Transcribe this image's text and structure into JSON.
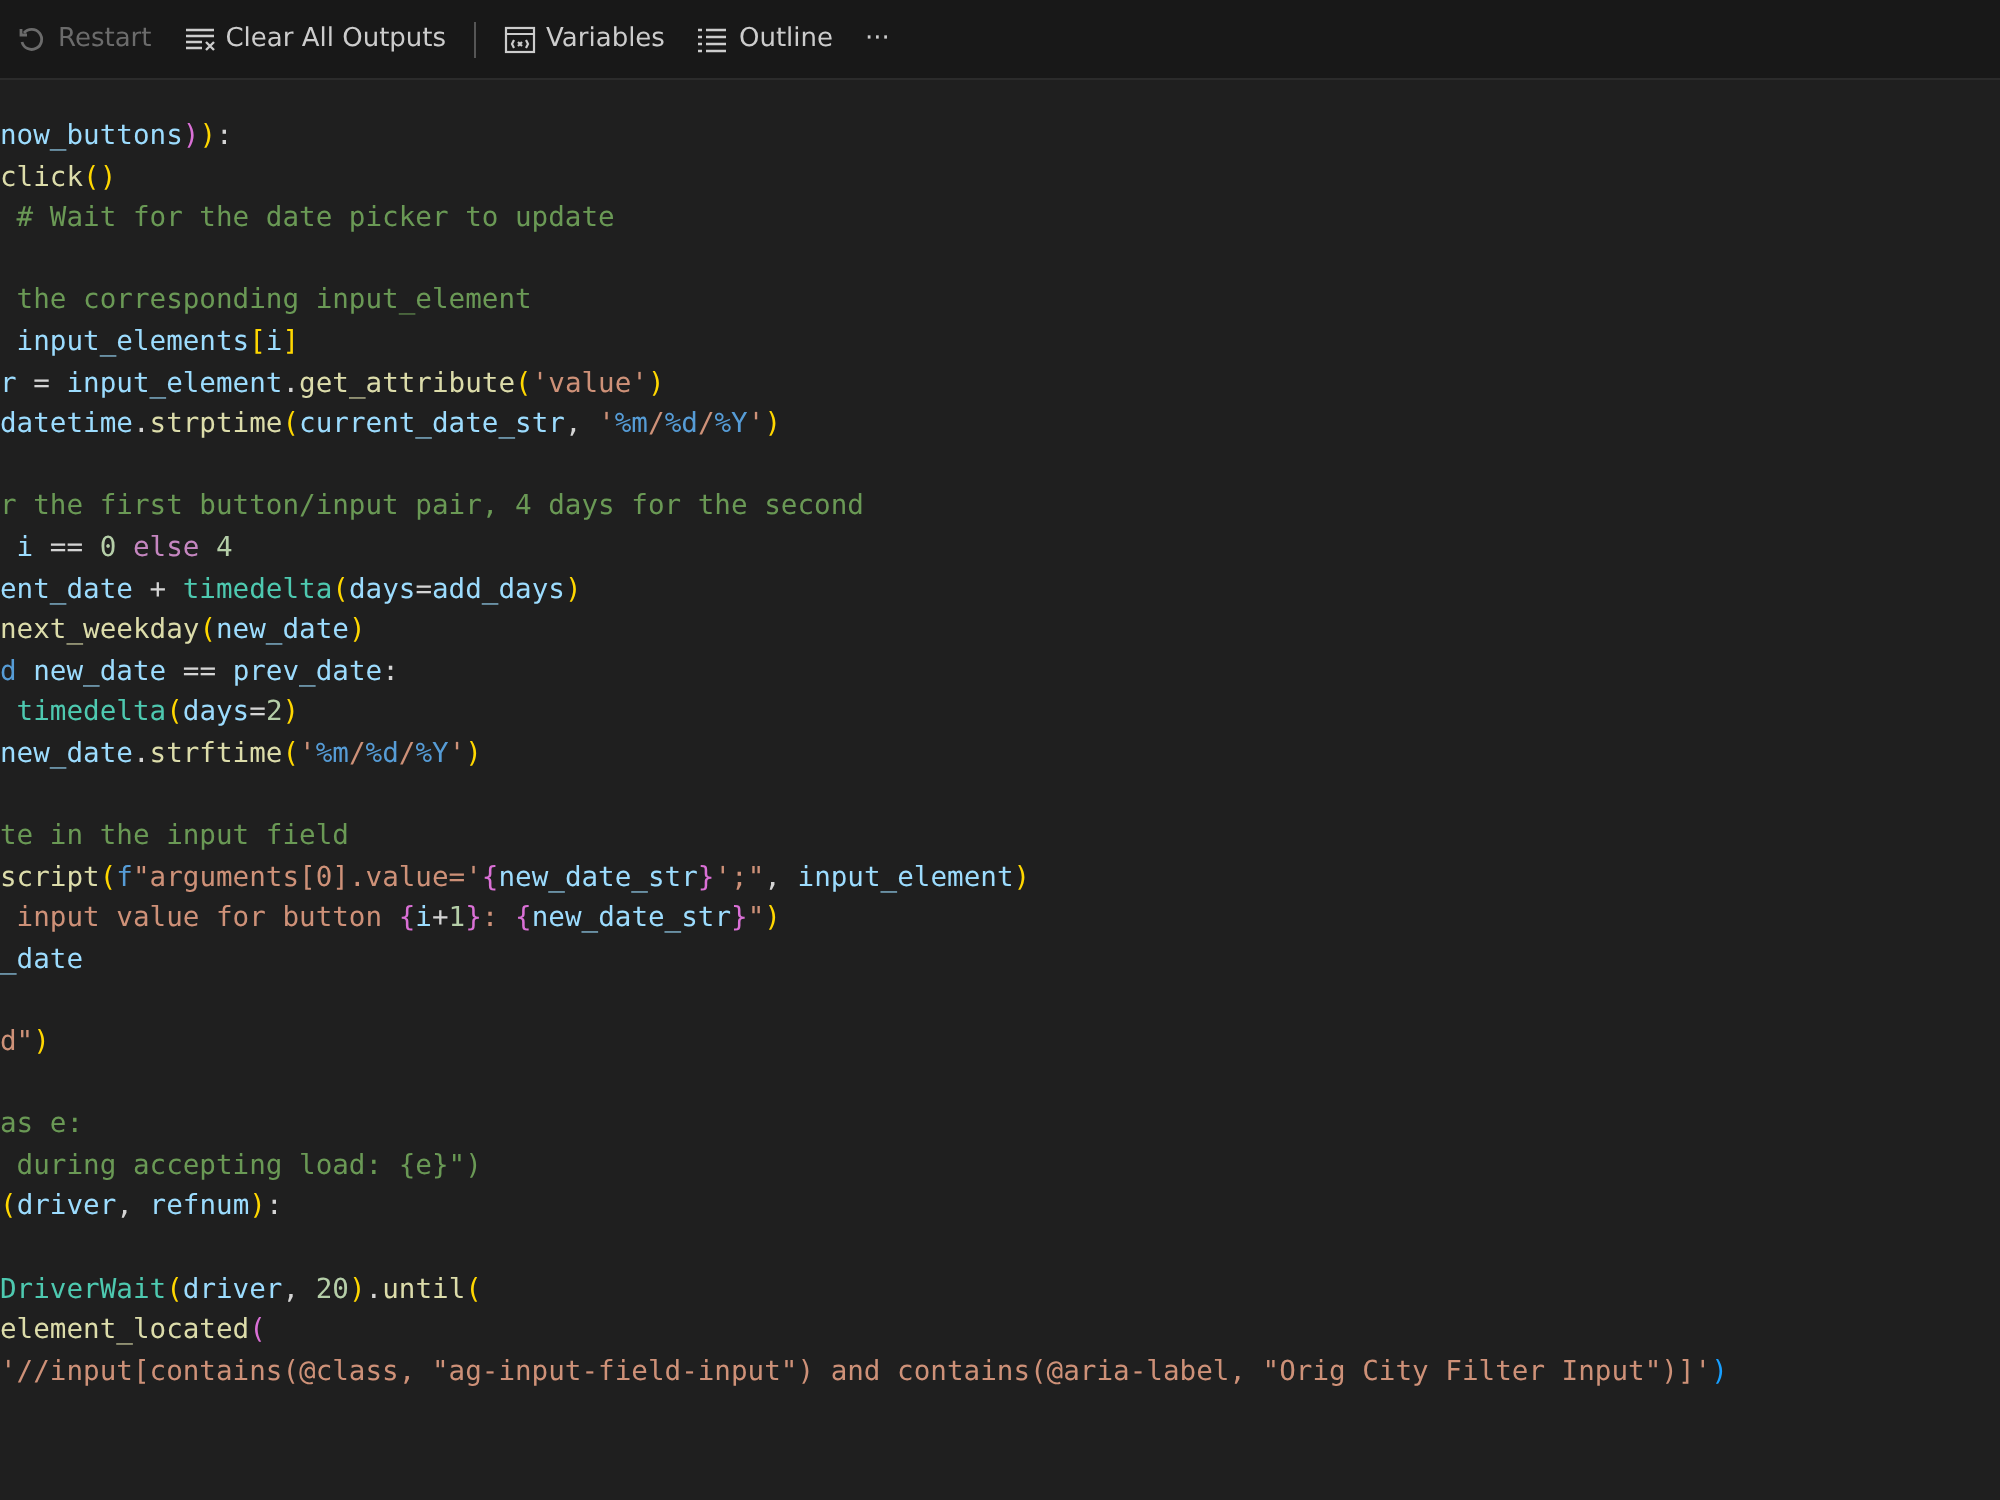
{
  "toolbar": [
    {
      "kind": "restart",
      "label": "Restart",
      "disabled": true
    },
    {
      "kind": "clear",
      "label": "Clear All Outputs",
      "disabled": false
    },
    {
      "kind": "separator"
    },
    {
      "kind": "variables",
      "label": "Variables",
      "disabled": false
    },
    {
      "kind": "outline",
      "label": "Outline",
      "disabled": false
    },
    {
      "kind": "more",
      "label": "···",
      "disabled": false
    }
  ],
  "code_lines": [
    {
      "kind": "code",
      "tokens": [
        {
          "text": "now_buttons",
          "kind": "var"
        },
        {
          "text": ")",
          "kind": "br2"
        },
        {
          "text": ")",
          "kind": "br1"
        },
        {
          "text": ":",
          "kind": "plain"
        }
      ]
    },
    {
      "kind": "code",
      "tokens": [
        {
          "text": "click",
          "kind": "fn"
        },
        {
          "text": "()",
          "kind": "br1"
        }
      ]
    },
    {
      "kind": "code",
      "tokens": [
        {
          "text": " # Wait for the date picker to update",
          "kind": "comment"
        }
      ]
    },
    {
      "kind": "blank"
    },
    {
      "kind": "code",
      "tokens": [
        {
          "text": " the corresponding input_element",
          "kind": "comment"
        }
      ]
    },
    {
      "kind": "code",
      "tokens": [
        {
          "text": " input_elements",
          "kind": "var"
        },
        {
          "text": "[",
          "kind": "br1"
        },
        {
          "text": "i",
          "kind": "var"
        },
        {
          "text": "]",
          "kind": "br1"
        }
      ]
    },
    {
      "kind": "code",
      "tokens": [
        {
          "text": "r",
          "kind": "var"
        },
        {
          "text": " = ",
          "kind": "plain"
        },
        {
          "text": "input_element",
          "kind": "var"
        },
        {
          "text": ".",
          "kind": "plain"
        },
        {
          "text": "get_attribute",
          "kind": "fn"
        },
        {
          "text": "(",
          "kind": "br1"
        },
        {
          "text": "'value'",
          "kind": "string"
        },
        {
          "text": ")",
          "kind": "br1"
        }
      ]
    },
    {
      "kind": "code",
      "tokens": [
        {
          "text": "datetime",
          "kind": "var"
        },
        {
          "text": ".",
          "kind": "plain"
        },
        {
          "text": "strptime",
          "kind": "fn"
        },
        {
          "text": "(",
          "kind": "br1"
        },
        {
          "text": "current_date_str",
          "kind": "var"
        },
        {
          "text": ", ",
          "kind": "plain"
        },
        {
          "text": "'",
          "kind": "string"
        },
        {
          "text": "%m",
          "kind": "const"
        },
        {
          "text": "/",
          "kind": "string"
        },
        {
          "text": "%d",
          "kind": "const"
        },
        {
          "text": "/",
          "kind": "string"
        },
        {
          "text": "%Y",
          "kind": "const"
        },
        {
          "text": "'",
          "kind": "string"
        },
        {
          "text": ")",
          "kind": "br1"
        }
      ]
    },
    {
      "kind": "blank"
    },
    {
      "kind": "code",
      "tokens": [
        {
          "text": "r the first button/input pair, 4 days for the second",
          "kind": "comment"
        }
      ]
    },
    {
      "kind": "code",
      "tokens": [
        {
          "text": " i",
          "kind": "var"
        },
        {
          "text": " == ",
          "kind": "plain"
        },
        {
          "text": "0",
          "kind": "number"
        },
        {
          "text": " else ",
          "kind": "keyword"
        },
        {
          "text": "4",
          "kind": "number"
        }
      ]
    },
    {
      "kind": "code",
      "tokens": [
        {
          "text": "ent_date",
          "kind": "var"
        },
        {
          "text": " + ",
          "kind": "plain"
        },
        {
          "text": "timedelta",
          "kind": "class"
        },
        {
          "text": "(",
          "kind": "br1"
        },
        {
          "text": "days",
          "kind": "var"
        },
        {
          "text": "=",
          "kind": "plain"
        },
        {
          "text": "add_days",
          "kind": "var"
        },
        {
          "text": ")",
          "kind": "br1"
        }
      ]
    },
    {
      "kind": "code",
      "tokens": [
        {
          "text": "next_weekday",
          "kind": "fn"
        },
        {
          "text": "(",
          "kind": "br1"
        },
        {
          "text": "new_date",
          "kind": "var"
        },
        {
          "text": ")",
          "kind": "br1"
        }
      ]
    },
    {
      "kind": "code",
      "tokens": [
        {
          "text": "d",
          "kind": "const"
        },
        {
          "text": " new_date",
          "kind": "var"
        },
        {
          "text": " == ",
          "kind": "plain"
        },
        {
          "text": "prev_date",
          "kind": "var"
        },
        {
          "text": ":",
          "kind": "plain"
        }
      ]
    },
    {
      "kind": "code",
      "tokens": [
        {
          "text": " timedelta",
          "kind": "class"
        },
        {
          "text": "(",
          "kind": "br1"
        },
        {
          "text": "days",
          "kind": "var"
        },
        {
          "text": "=",
          "kind": "plain"
        },
        {
          "text": "2",
          "kind": "number"
        },
        {
          "text": ")",
          "kind": "br1"
        }
      ]
    },
    {
      "kind": "code",
      "tokens": [
        {
          "text": "new_date",
          "kind": "var"
        },
        {
          "text": ".",
          "kind": "plain"
        },
        {
          "text": "strftime",
          "kind": "fn"
        },
        {
          "text": "(",
          "kind": "br1"
        },
        {
          "text": "'",
          "kind": "string"
        },
        {
          "text": "%m",
          "kind": "const"
        },
        {
          "text": "/",
          "kind": "string"
        },
        {
          "text": "%d",
          "kind": "const"
        },
        {
          "text": "/",
          "kind": "string"
        },
        {
          "text": "%Y",
          "kind": "const"
        },
        {
          "text": "'",
          "kind": "string"
        },
        {
          "text": ")",
          "kind": "br1"
        }
      ]
    },
    {
      "kind": "blank"
    },
    {
      "kind": "code",
      "tokens": [
        {
          "text": "te in the input field",
          "kind": "comment"
        }
      ]
    },
    {
      "kind": "code",
      "tokens": [
        {
          "text": "script",
          "kind": "fn"
        },
        {
          "text": "(",
          "kind": "br1"
        },
        {
          "text": "f",
          "kind": "const"
        },
        {
          "text": "\"arguments[0].value='",
          "kind": "string"
        },
        {
          "text": "{",
          "kind": "br2"
        },
        {
          "text": "new_date_str",
          "kind": "var"
        },
        {
          "text": "}",
          "kind": "br2"
        },
        {
          "text": "';\"",
          "kind": "string"
        },
        {
          "text": ", ",
          "kind": "plain"
        },
        {
          "text": "input_element",
          "kind": "var"
        },
        {
          "text": ")",
          "kind": "br1"
        }
      ]
    },
    {
      "kind": "code",
      "tokens": [
        {
          "text": " input value for button ",
          "kind": "string"
        },
        {
          "text": "{",
          "kind": "br2"
        },
        {
          "text": "i",
          "kind": "var"
        },
        {
          "text": "+",
          "kind": "plain"
        },
        {
          "text": "1",
          "kind": "number"
        },
        {
          "text": "}",
          "kind": "br2"
        },
        {
          "text": ": ",
          "kind": "string"
        },
        {
          "text": "{",
          "kind": "br2"
        },
        {
          "text": "new_date_str",
          "kind": "var"
        },
        {
          "text": "}",
          "kind": "br2"
        },
        {
          "text": "\"",
          "kind": "string"
        },
        {
          "text": ")",
          "kind": "br1"
        }
      ]
    },
    {
      "kind": "code",
      "tokens": [
        {
          "text": "_date",
          "kind": "var"
        }
      ]
    },
    {
      "kind": "blank"
    },
    {
      "kind": "code",
      "tokens": [
        {
          "text": "d\"",
          "kind": "string"
        },
        {
          "text": ")",
          "kind": "br1"
        }
      ]
    },
    {
      "kind": "blank"
    },
    {
      "kind": "code",
      "tokens": [
        {
          "text": "as e:",
          "kind": "comment"
        }
      ]
    },
    {
      "kind": "code",
      "tokens": [
        {
          "text": " during accepting load: {e}\")",
          "kind": "comment"
        }
      ]
    },
    {
      "kind": "code",
      "tokens": [
        {
          "text": "(",
          "kind": "br1"
        },
        {
          "text": "driver",
          "kind": "var"
        },
        {
          "text": ", ",
          "kind": "plain"
        },
        {
          "text": "refnum",
          "kind": "var"
        },
        {
          "text": ")",
          "kind": "br1"
        },
        {
          "text": ":",
          "kind": "plain"
        }
      ]
    },
    {
      "kind": "blank"
    },
    {
      "kind": "code",
      "tokens": [
        {
          "text": "DriverWait",
          "kind": "class"
        },
        {
          "text": "(",
          "kind": "br1"
        },
        {
          "text": "driver",
          "kind": "var"
        },
        {
          "text": ", ",
          "kind": "plain"
        },
        {
          "text": "20",
          "kind": "number"
        },
        {
          "text": ")",
          "kind": "br1"
        },
        {
          "text": ".",
          "kind": "plain"
        },
        {
          "text": "until",
          "kind": "fn"
        },
        {
          "text": "(",
          "kind": "br1"
        }
      ]
    },
    {
      "kind": "code",
      "tokens": [
        {
          "text": "element_located",
          "kind": "fn"
        },
        {
          "text": "(",
          "kind": "br2"
        }
      ]
    },
    {
      "kind": "code",
      "tokens": [
        {
          "text": "'//input[contains(@class, \"ag-input-field-input\") and contains(@aria-label, \"Orig City Filter Input\")]'",
          "kind": "string"
        },
        {
          "text": ")",
          "kind": "br3"
        }
      ]
    }
  ]
}
